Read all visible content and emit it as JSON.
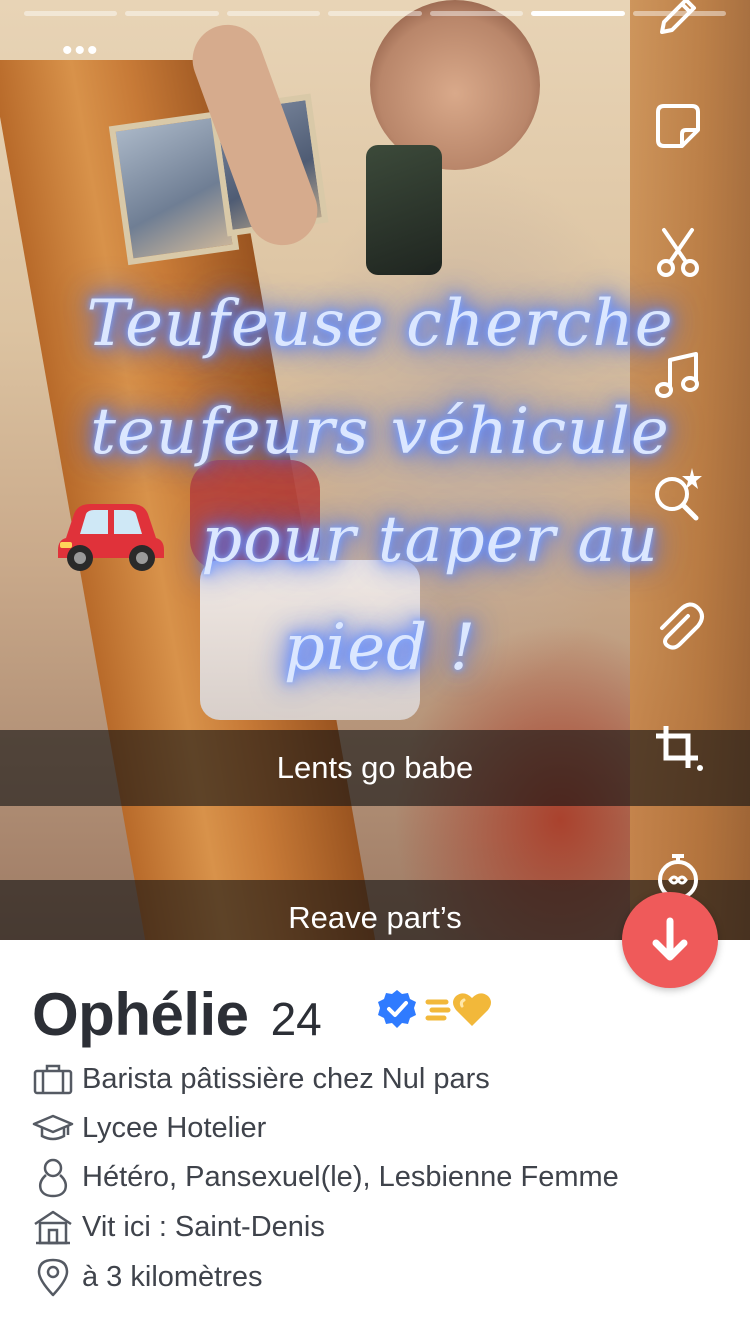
{
  "story": {
    "segments_total": 7,
    "active_segment": 5,
    "more_icon": "more-dots-icon",
    "caption_lines": [
      "Teufeuse cherche",
      "teufeurs véhicule",
      "pour taper au",
      "pied !"
    ],
    "caption_emoji": "car-emoji",
    "snap_texts": [
      "Lents go babe",
      "Reave part’s"
    ],
    "tools": [
      "pencil-icon",
      "sticker-icon",
      "scissors-icon",
      "music-note-icon",
      "lens-search-icon",
      "paperclip-icon",
      "crop-icon",
      "timer-icon"
    ]
  },
  "actions": {
    "down_icon": "arrow-down-icon",
    "down_color": "#ef5a5a"
  },
  "profile": {
    "name": "Ophélie",
    "age": "24",
    "verified_icon": "verified-badge-icon",
    "verified_color": "#2f7bff",
    "superlike_icon": "superlike-heart-icon",
    "superlike_color": "#f2b83a",
    "details": [
      {
        "icon": "briefcase-icon",
        "text": "Barista pâtissière chez Nul pars"
      },
      {
        "icon": "graduation-cap-icon",
        "text": "Lycee Hotelier"
      },
      {
        "icon": "person-icon",
        "text": "Hétéro, Pansexuel(le), Lesbienne Femme"
      },
      {
        "icon": "house-icon",
        "text": "Vit ici : Saint-Denis"
      },
      {
        "icon": "location-pin-icon",
        "text": "à 3 kilomètres"
      }
    ]
  }
}
